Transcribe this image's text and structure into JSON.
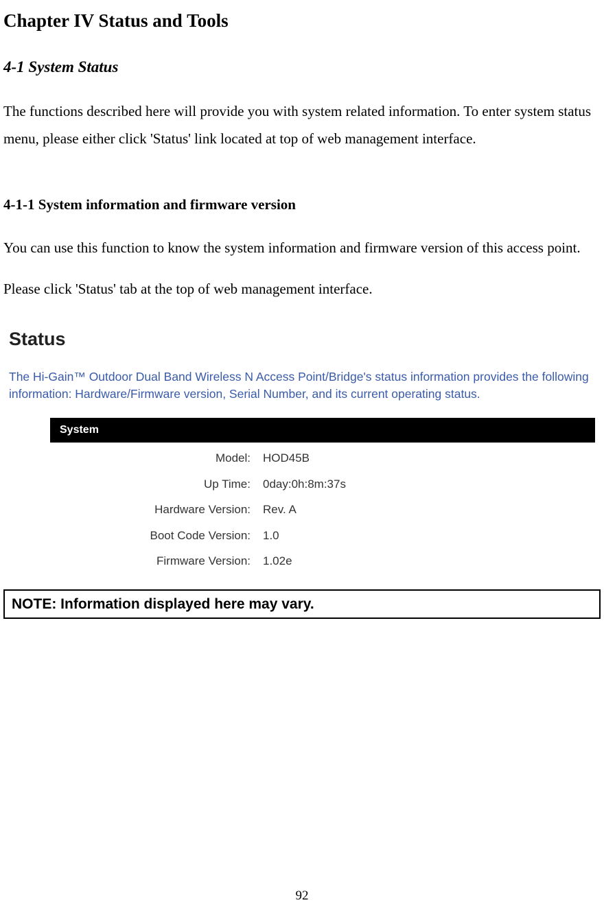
{
  "chapter_title": "Chapter IV Status and Tools",
  "section_title": "4-1 System Status",
  "intro_paragraph": "The functions described here will provide you with system related information. To enter system status menu, please either click 'Status' link located at top of web management interface.",
  "subsection_title": "4-1-1 System information and firmware version",
  "subsection_p1": "You can use this function to know the system information and firmware version of this access point.",
  "subsection_p2": "Please click 'Status' tab at the top of web management interface.",
  "status": {
    "heading": "Status",
    "description": "The Hi-Gain™ Outdoor Dual Band Wireless N Access Point/Bridge's status information provides the following information: Hardware/Firmware version, Serial Number, and its current operating status.",
    "panel_title": "System",
    "rows": [
      {
        "label": "Model:",
        "value": "HOD45B"
      },
      {
        "label": "Up Time:",
        "value": "0day:0h:8m:37s"
      },
      {
        "label": "Hardware Version:",
        "value": "Rev. A"
      },
      {
        "label": "Boot Code Version:",
        "value": "1.0"
      },
      {
        "label": "Firmware Version:",
        "value": "1.02e"
      }
    ]
  },
  "note_text": "NOTE: Information displayed here may vary.",
  "page_number": "92"
}
